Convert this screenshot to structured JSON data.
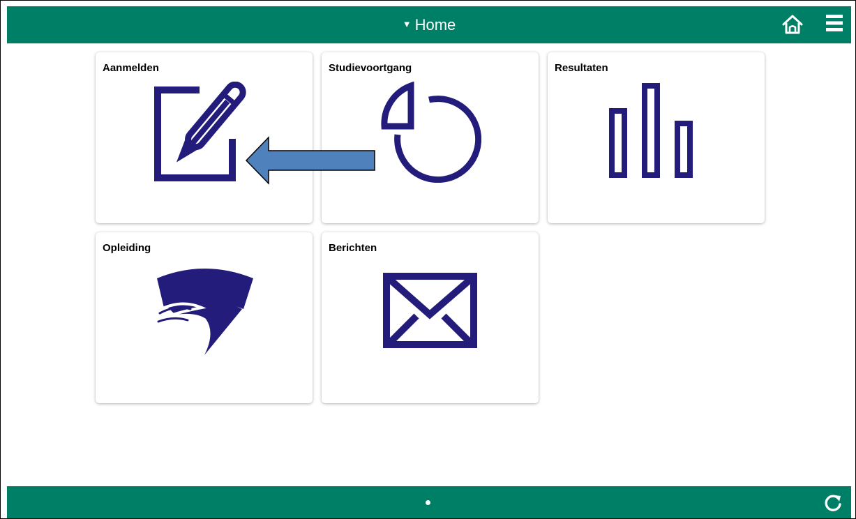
{
  "header": {
    "title": "Home",
    "caret_icon": "caret-down-icon",
    "home_icon": "home-icon",
    "menu_icon": "hamburger-menu-icon",
    "bar_color": "#007f67"
  },
  "tiles": [
    {
      "title": "Aanmelden",
      "icon": "edit-pencil-icon"
    },
    {
      "title": "Studievoortgang",
      "icon": "pie-chart-icon"
    },
    {
      "title": "Resultaten",
      "icon": "bar-chart-icon"
    },
    {
      "title": "Opleiding",
      "icon": "education-logo-icon"
    },
    {
      "title": "Berichten",
      "icon": "envelope-icon"
    }
  ],
  "icon_color": "#231c7b",
  "annotation": {
    "icon": "arrow-left-icon",
    "color": "#4f81bd"
  },
  "footer": {
    "page_indicator": "page-dot",
    "refresh_icon": "refresh-icon",
    "bar_color": "#007f67"
  }
}
